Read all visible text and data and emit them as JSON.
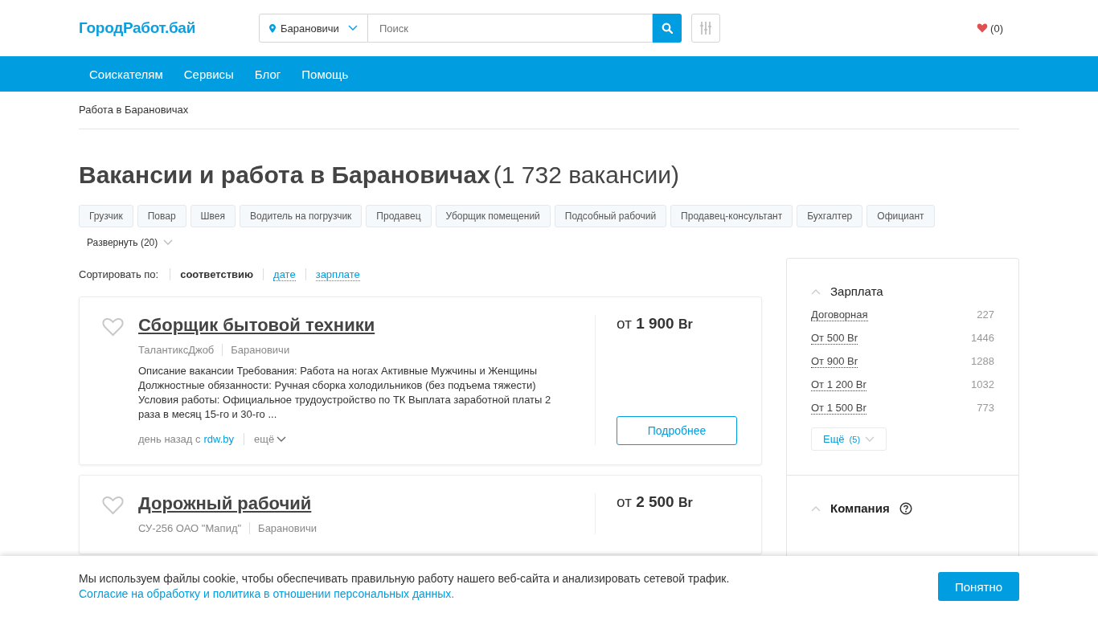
{
  "header": {
    "logo": "ГородРабот.бай",
    "city": "Барановичи",
    "search": {
      "placeholder": "Поиск"
    },
    "favorites": "(0)"
  },
  "nav": [
    "Соискателям",
    "Сервисы",
    "Блог",
    "Помощь"
  ],
  "breadcrumb": "Работа в Барановичах",
  "heading": {
    "title": "Вакансии и работа в Барановичах",
    "count": "(1 732 вакансии)"
  },
  "tags": [
    "Грузчик",
    "Повар",
    "Швея",
    "Водитель на погрузчик",
    "Продавец",
    "Уборщик помещений",
    "Подсобный рабочий",
    "Продавец-консультант",
    "Бухгалтер",
    "Официант"
  ],
  "expand": "Развернуть (20)",
  "sort": {
    "label": "Сортировать по:",
    "options": [
      {
        "label": "соответствию",
        "selected": true
      },
      {
        "label": "дате",
        "selected": false
      },
      {
        "label": "зарплате",
        "selected": false
      }
    ]
  },
  "vacancies": [
    {
      "title": "Сборщик бытовой техники",
      "company": "ТалантиксДжоб",
      "location": "Барановичи",
      "description": "Описание вакансии Требования: Работа на ногах Активные Мужчины и Женщины Должностные обязанности: Ручная сборка холодильников (без подъема тяжести) Условия работы: Официальное трудоустройство по ТК Выплата заработной платы 2 раза в месяц 15-го и 30-го ...",
      "posted": "день назад с",
      "source": "rdw.by",
      "more": "ещё",
      "salary_prefix": "от",
      "salary": "1 900",
      "currency": "Br",
      "button": "Подробнее"
    },
    {
      "title": "Дорожный рабочий",
      "company": "СУ-256 ОАО \"Мапид\"",
      "location": "Барановичи",
      "salary_prefix": "от",
      "salary": "2 500",
      "currency": "Br"
    }
  ],
  "filters": {
    "salary": {
      "title": "Зарплата",
      "options": [
        {
          "label": "Договорная",
          "count": "227"
        },
        {
          "label": "От 500 Br",
          "count": "1446"
        },
        {
          "label": "От 900 Br",
          "count": "1288"
        },
        {
          "label": "От 1 200 Br",
          "count": "1032"
        },
        {
          "label": "От 1 500 Br",
          "count": "773"
        }
      ],
      "more": "Ещё",
      "more_count": "(5)"
    },
    "company": {
      "title": "Компания"
    }
  },
  "cookie": {
    "text": "Мы используем файлы cookie, чтобы обеспечивать правильную работу нашего веб-сайта и анализировать сетевой трафик.",
    "link": "Согласие на обработку и политика в отношении персональных данных.",
    "button": "Понятно"
  }
}
